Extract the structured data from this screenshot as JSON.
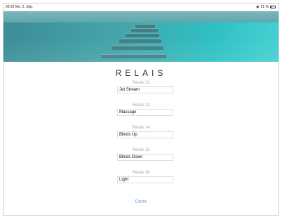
{
  "status_bar": {
    "time": "09:22",
    "date": "Mo. 2. Sep.",
    "battery_text": "21 %",
    "battery_level": 0.21,
    "wifi_icon": "wifi-icon"
  },
  "page": {
    "title": "RELAIS",
    "done_label": "Done"
  },
  "relays": [
    {
      "label": "Relais 12",
      "value": "Jet Stream"
    },
    {
      "label": "Relais 13",
      "value": "Massage"
    },
    {
      "label": "Relais 14",
      "value": "Blinds Up"
    },
    {
      "label": "Relais 15",
      "value": "Blinds Down"
    },
    {
      "label": "Relais 16",
      "value": "Light"
    }
  ],
  "colors": {
    "accent": "#6aa6d8",
    "hero_water": "#2fc0c4"
  }
}
